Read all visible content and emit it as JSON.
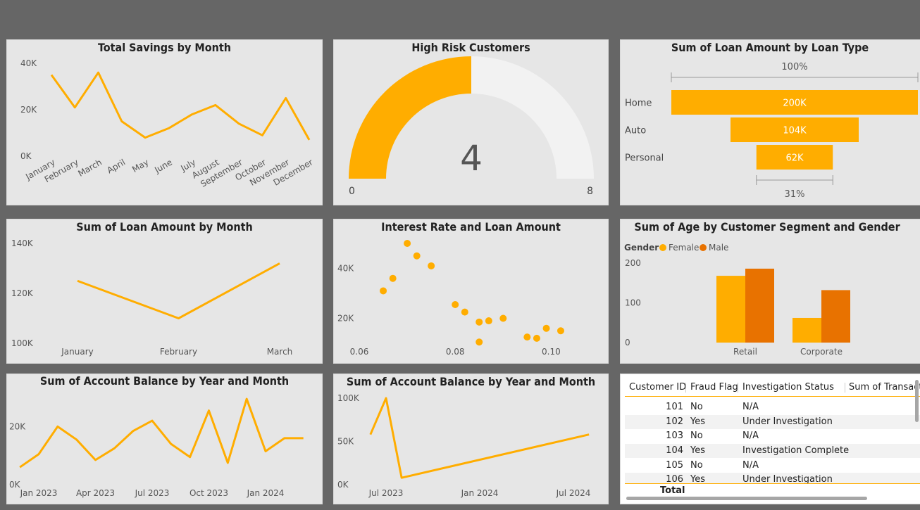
{
  "tiles": {
    "savings": {
      "title": "Total Savings by Month"
    },
    "risk": {
      "title": "High Risk Customers"
    },
    "funnel": {
      "title": "Sum of Loan Amount by Loan Type"
    },
    "loanMonth": {
      "title": "Sum of Loan Amount by Month"
    },
    "scatter": {
      "title": "Interest Rate and Loan Amount"
    },
    "age": {
      "title": "Sum of Age by Customer Segment and Gender"
    },
    "balance1": {
      "title": "Sum of Account Balance by Year and Month"
    },
    "balance2": {
      "title": "Sum of Account Balance by Year and Month"
    }
  },
  "colors": {
    "accent": "#ffad00",
    "male": "#e87200",
    "track": "#f2f2f2",
    "bg": "#e6e6e6"
  },
  "chart_data": [
    {
      "id": "savings",
      "type": "line",
      "categories": [
        "January",
        "February",
        "March",
        "April",
        "May",
        "June",
        "July",
        "August",
        "September",
        "October",
        "November",
        "December"
      ],
      "values": [
        35000,
        21000,
        36000,
        15000,
        8000,
        12000,
        18000,
        22000,
        14000,
        9000,
        25000,
        7000
      ],
      "yticks": [
        0,
        20000,
        40000
      ],
      "ytick_labels": [
        "0K",
        "20K",
        "40K"
      ],
      "ylim": [
        0,
        40000
      ]
    },
    {
      "id": "risk",
      "type": "gauge",
      "value": 4,
      "min": 0,
      "max": 8,
      "value_label": "4",
      "min_label": "0",
      "max_label": "8"
    },
    {
      "id": "funnel",
      "type": "funnel",
      "categories": [
        "Home",
        "Auto",
        "Personal"
      ],
      "values": [
        200000,
        104000,
        62000
      ],
      "value_labels": [
        "200K",
        "104K",
        "62K"
      ],
      "top_label": "100%",
      "bottom_label": "31%"
    },
    {
      "id": "loanMonth",
      "type": "line",
      "categories": [
        "January",
        "February",
        "March"
      ],
      "values": [
        125000,
        110000,
        132000
      ],
      "yticks": [
        100000,
        120000,
        140000
      ],
      "ytick_labels": [
        "100K",
        "120K",
        "140K"
      ],
      "ylim": [
        100000,
        140000
      ]
    },
    {
      "id": "scatter",
      "type": "scatter",
      "x": [
        0.065,
        0.067,
        0.07,
        0.072,
        0.075,
        0.08,
        0.082,
        0.085,
        0.085,
        0.087,
        0.09,
        0.095,
        0.097,
        0.099,
        0.102
      ],
      "y": [
        31000,
        36000,
        50000,
        45000,
        41000,
        25500,
        22500,
        18500,
        10500,
        19000,
        20000,
        12500,
        12000,
        16000,
        15000
      ],
      "xticks": [
        0.06,
        0.08,
        0.1
      ],
      "xtick_labels": [
        "0.06",
        "0.08",
        "0.10"
      ],
      "xlim": [
        0.06,
        0.1045
      ],
      "yticks": [
        20000,
        40000
      ],
      "ytick_labels": [
        "20K",
        "40K"
      ],
      "ylim": [
        10000,
        50000
      ]
    },
    {
      "id": "age",
      "type": "bar",
      "categories": [
        "Retail",
        "Corporate"
      ],
      "legend_title": "Gender",
      "series": [
        {
          "name": "Female",
          "values": [
            168,
            62
          ]
        },
        {
          "name": "Male",
          "values": [
            186,
            132
          ]
        }
      ],
      "yticks": [
        0,
        100,
        200
      ],
      "ytick_labels": [
        "0",
        "100",
        "200"
      ],
      "ylim": [
        0,
        200
      ]
    },
    {
      "id": "balance1",
      "type": "line",
      "x_labels": [
        "Jan 2023",
        "Apr 2023",
        "Jul 2023",
        "Oct 2023",
        "Jan 2024"
      ],
      "x": [
        "2022-12",
        "2023-01",
        "2023-02",
        "2023-03",
        "2023-04",
        "2023-05",
        "2023-06",
        "2023-07",
        "2023-08",
        "2023-09",
        "2023-10",
        "2023-11",
        "2023-12",
        "2024-01",
        "2024-02",
        "2024-03"
      ],
      "values": [
        6000,
        10500,
        20000,
        15500,
        8500,
        12500,
        18500,
        22000,
        14000,
        9500,
        25500,
        7500,
        29500,
        11500,
        16000,
        16000
      ],
      "yticks": [
        0,
        20000
      ],
      "ytick_labels": [
        "0K",
        "20K"
      ],
      "ylim": [
        0,
        30000
      ]
    },
    {
      "id": "balance2",
      "type": "line",
      "x_labels": [
        "Jul 2023",
        "Jan 2024",
        "Jul 2024"
      ],
      "x": [
        "2023-06",
        "2023-07",
        "2023-08",
        "2024-08"
      ],
      "values": [
        58000,
        100000,
        8000,
        58000
      ],
      "yticks": [
        0,
        50000,
        100000
      ],
      "ytick_labels": [
        "0K",
        "50K",
        "100K"
      ],
      "ylim": [
        0,
        100000
      ]
    }
  ],
  "table": {
    "headers": [
      "Customer ID",
      "Fraud Flag",
      "Investigation Status",
      "Sum of Transact"
    ],
    "rows": [
      {
        "id": "101",
        "fraud": "No",
        "status": "N/A"
      },
      {
        "id": "102",
        "fraud": "Yes",
        "status": "Under Investigation"
      },
      {
        "id": "103",
        "fraud": "No",
        "status": "N/A"
      },
      {
        "id": "104",
        "fraud": "Yes",
        "status": "Investigation Complete"
      },
      {
        "id": "105",
        "fraud": "No",
        "status": "N/A"
      },
      {
        "id": "106",
        "fraud": "Yes",
        "status": "Under Investigation"
      }
    ],
    "total_label": "Total"
  }
}
